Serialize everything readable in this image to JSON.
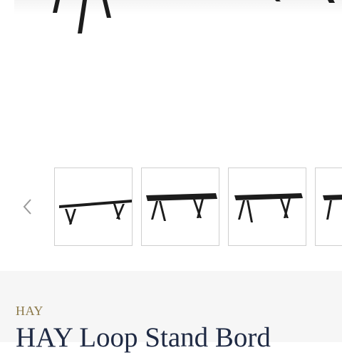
{
  "product": {
    "brand": "HAY",
    "title": "HAY Loop Stand Bord"
  },
  "gallery": {
    "prev_icon": "chevron-left-icon",
    "thumbnails": [
      {
        "name": "thumbnail-1"
      },
      {
        "name": "thumbnail-2"
      },
      {
        "name": "thumbnail-3"
      },
      {
        "name": "thumbnail-4"
      }
    ]
  },
  "colors": {
    "brand": "#8c7a4a",
    "title": "#1f2a44",
    "info_background": "#f6f6f6",
    "thumb_border": "#cfcfcf",
    "table": "#1c1c1c"
  }
}
